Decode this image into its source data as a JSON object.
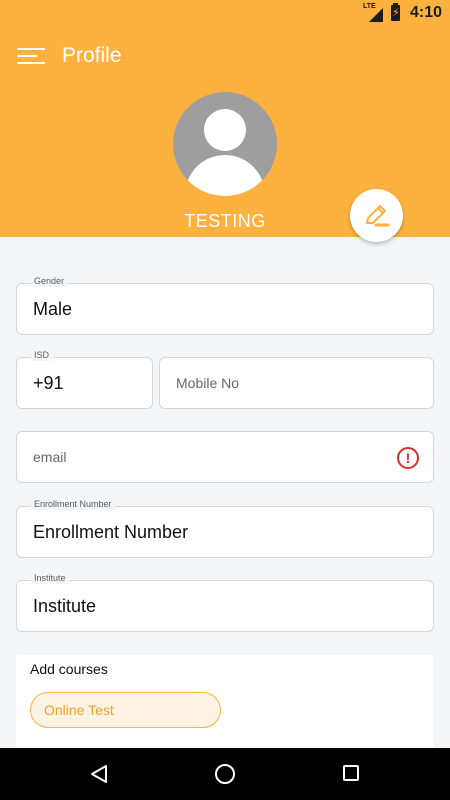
{
  "status_bar": {
    "network": "LTE",
    "time": "4:10"
  },
  "header": {
    "title": "Profile",
    "user_name": "TESTING"
  },
  "colors": {
    "accent": "#fdb240",
    "error": "#d32f2f",
    "background": "#f3f6f9"
  },
  "icons": {
    "menu": "menu-icon",
    "avatar": "avatar-placeholder",
    "edit": "pencil-icon",
    "error": "alert-circle-icon"
  },
  "form": {
    "gender": {
      "label": "Gender",
      "value": "Male"
    },
    "isd": {
      "label": "ISD",
      "value": "+91"
    },
    "mobile": {
      "placeholder": "Mobile No"
    },
    "email": {
      "placeholder": "email"
    },
    "enrollment": {
      "label": "Enrollment Number",
      "value": "Enrollment Number"
    },
    "institute": {
      "label": "Institute",
      "value": "Institute"
    }
  },
  "courses": {
    "title": "Add courses",
    "items": [
      "Online Test"
    ]
  },
  "nav": {
    "back": "back-icon",
    "home": "home-icon",
    "recent": "recent-apps-icon"
  }
}
